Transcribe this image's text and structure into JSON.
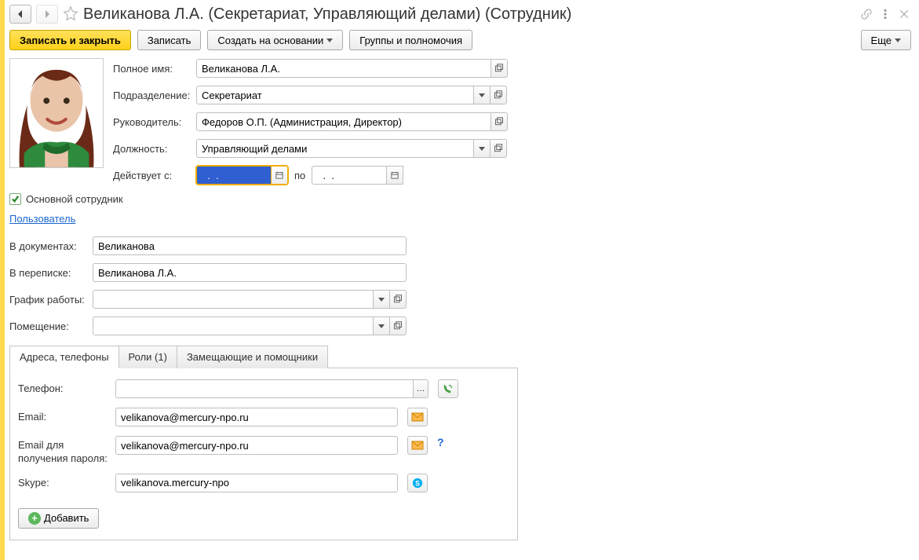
{
  "title": "Великанова Л.А. (Секретариат, Управляющий делами) (Сотрудник)",
  "toolbar": {
    "save_close": "Записать и закрыть",
    "save": "Записать",
    "create_based": "Создать на основании",
    "groups": "Группы и полномочия",
    "more": "Еще"
  },
  "fields": {
    "full_name_label": "Полное имя:",
    "full_name": "Великанова Л.А.",
    "department_label": "Подразделение:",
    "department": "Секретариат",
    "manager_label": "Руководитель:",
    "manager": "Федоров О.П. (Администрация, Директор)",
    "position_label": "Должность:",
    "position": "Управляющий делами",
    "valid_from_label": "Действует с:",
    "valid_from": "  .  .    ",
    "valid_to_label": "по",
    "valid_to": "  .  .    "
  },
  "main_employee_label": "Основной сотрудник",
  "user_link": "Пользователь",
  "lower": {
    "in_docs_label": "В документах:",
    "in_docs": "Великанова",
    "in_mail_label": "В переписке:",
    "in_mail": "Великанова Л.А.",
    "schedule_label": "График работы:",
    "schedule": "",
    "room_label": "Помещение:",
    "room": ""
  },
  "tabs": {
    "tab1": "Адреса, телефоны",
    "tab2": "Роли (1)",
    "tab3": "Замещающие и помощники"
  },
  "contacts": {
    "phone_label": "Телефон:",
    "phone": "",
    "email_label": "Email:",
    "email": "velikanova@mercury-npo.ru",
    "email_pwd_label": "Email для получения пароля:",
    "email_pwd": "velikanova@mercury-npo.ru",
    "skype_label": "Skype:",
    "skype": "velikanova.mercury-npo",
    "add": "Добавить"
  }
}
